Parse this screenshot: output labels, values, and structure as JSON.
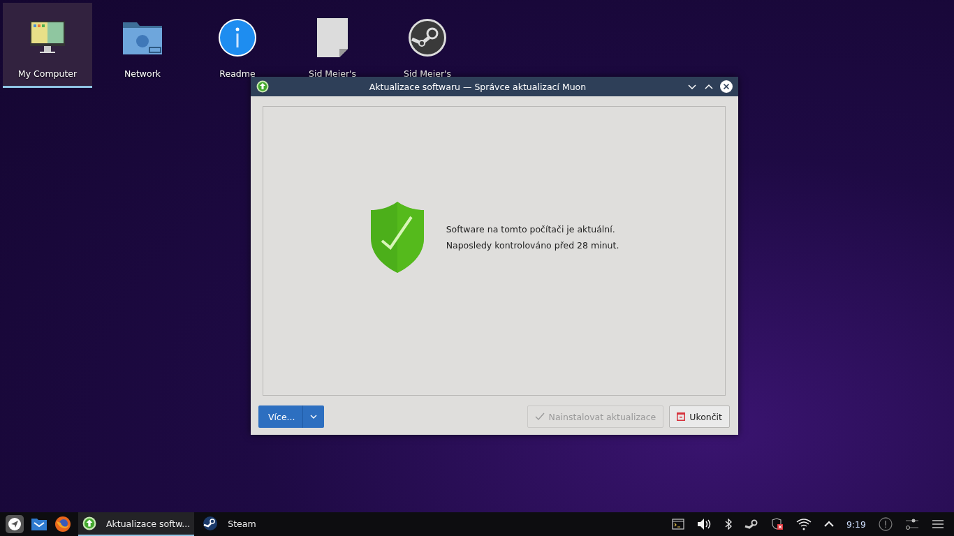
{
  "desktop_icons": [
    {
      "label": "My Computer",
      "kind": "computer",
      "selected": true
    },
    {
      "label": "Network",
      "kind": "folder",
      "selected": false
    },
    {
      "label": "Readme",
      "kind": "info",
      "selected": false
    },
    {
      "label": "Sid Meier's",
      "kind": "document",
      "selected": false
    },
    {
      "label": "Sid Meier's",
      "kind": "steam",
      "selected": false
    }
  ],
  "window": {
    "title": "Aktualizace softwaru — Správce aktualizací Muon",
    "messages": [
      "Software na tomto počítači je aktuální.",
      "Naposledy kontrolováno před 28 minut."
    ],
    "more_button": {
      "label": "Více..."
    },
    "install_button": {
      "label": "Nainstalovat aktualizace",
      "disabled": true
    },
    "quit_button": {
      "label": "Ukončit"
    }
  },
  "taskbar": {
    "launchers": [
      {
        "kind": "mail"
      },
      {
        "kind": "browser"
      }
    ],
    "tasks": [
      {
        "label": "Aktualizace softw...",
        "kind": "updater",
        "selected": true
      },
      {
        "label": "Steam",
        "kind": "steam",
        "selected": false
      }
    ],
    "tray": [
      {
        "kind": "terminal"
      },
      {
        "kind": "volume"
      },
      {
        "kind": "bluetooth"
      },
      {
        "kind": "steam"
      },
      {
        "kind": "shield"
      },
      {
        "kind": "wifi"
      },
      {
        "kind": "expand"
      }
    ],
    "clock": "9:19"
  }
}
